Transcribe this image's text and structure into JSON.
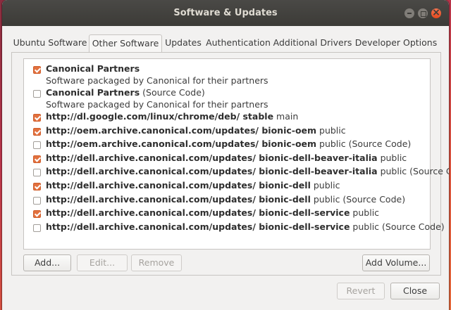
{
  "window": {
    "title": "Software & Updates"
  },
  "tabs": [
    {
      "label": "Ubuntu Software"
    },
    {
      "label": "Other Software"
    },
    {
      "label": "Updates"
    },
    {
      "label": "Authentication"
    },
    {
      "label": "Additional Drivers"
    },
    {
      "label": "Developer Options"
    }
  ],
  "sources": [
    {
      "checked": true,
      "bold": "Canonical Partners",
      "rest": "",
      "sub": "Software packaged by Canonical for their partners"
    },
    {
      "checked": false,
      "bold": "Canonical Partners",
      "rest": " (Source Code)",
      "sub": "Software packaged by Canonical for their partners"
    },
    {
      "checked": true,
      "bold": "http://dl.google.com/linux/chrome/deb/ stable",
      "rest": " main"
    },
    {
      "checked": true,
      "bold": "http://oem.archive.canonical.com/updates/ bionic-oem",
      "rest": " public"
    },
    {
      "checked": false,
      "bold": "http://oem.archive.canonical.com/updates/ bionic-oem",
      "rest": " public (Source Code)"
    },
    {
      "checked": true,
      "bold": "http://dell.archive.canonical.com/updates/ bionic-dell-beaver-italia",
      "rest": " public"
    },
    {
      "checked": false,
      "bold": "http://dell.archive.canonical.com/updates/ bionic-dell-beaver-italia",
      "rest": " public (Source Code)"
    },
    {
      "checked": true,
      "bold": "http://dell.archive.canonical.com/updates/ bionic-dell",
      "rest": " public"
    },
    {
      "checked": false,
      "bold": "http://dell.archive.canonical.com/updates/ bionic-dell",
      "rest": " public (Source Code)"
    },
    {
      "checked": true,
      "bold": "http://dell.archive.canonical.com/updates/ bionic-dell-service",
      "rest": " public"
    },
    {
      "checked": false,
      "bold": "http://dell.archive.canonical.com/updates/ bionic-dell-service",
      "rest": " public (Source Code)"
    }
  ],
  "buttons": {
    "add": "Add...",
    "edit": "Edit...",
    "remove": "Remove",
    "add_volume": "Add Volume...",
    "revert": "Revert",
    "close": "Close"
  },
  "colors": {
    "checkbox_accent": "#e2713f",
    "titlebar": "#3c3b37"
  }
}
